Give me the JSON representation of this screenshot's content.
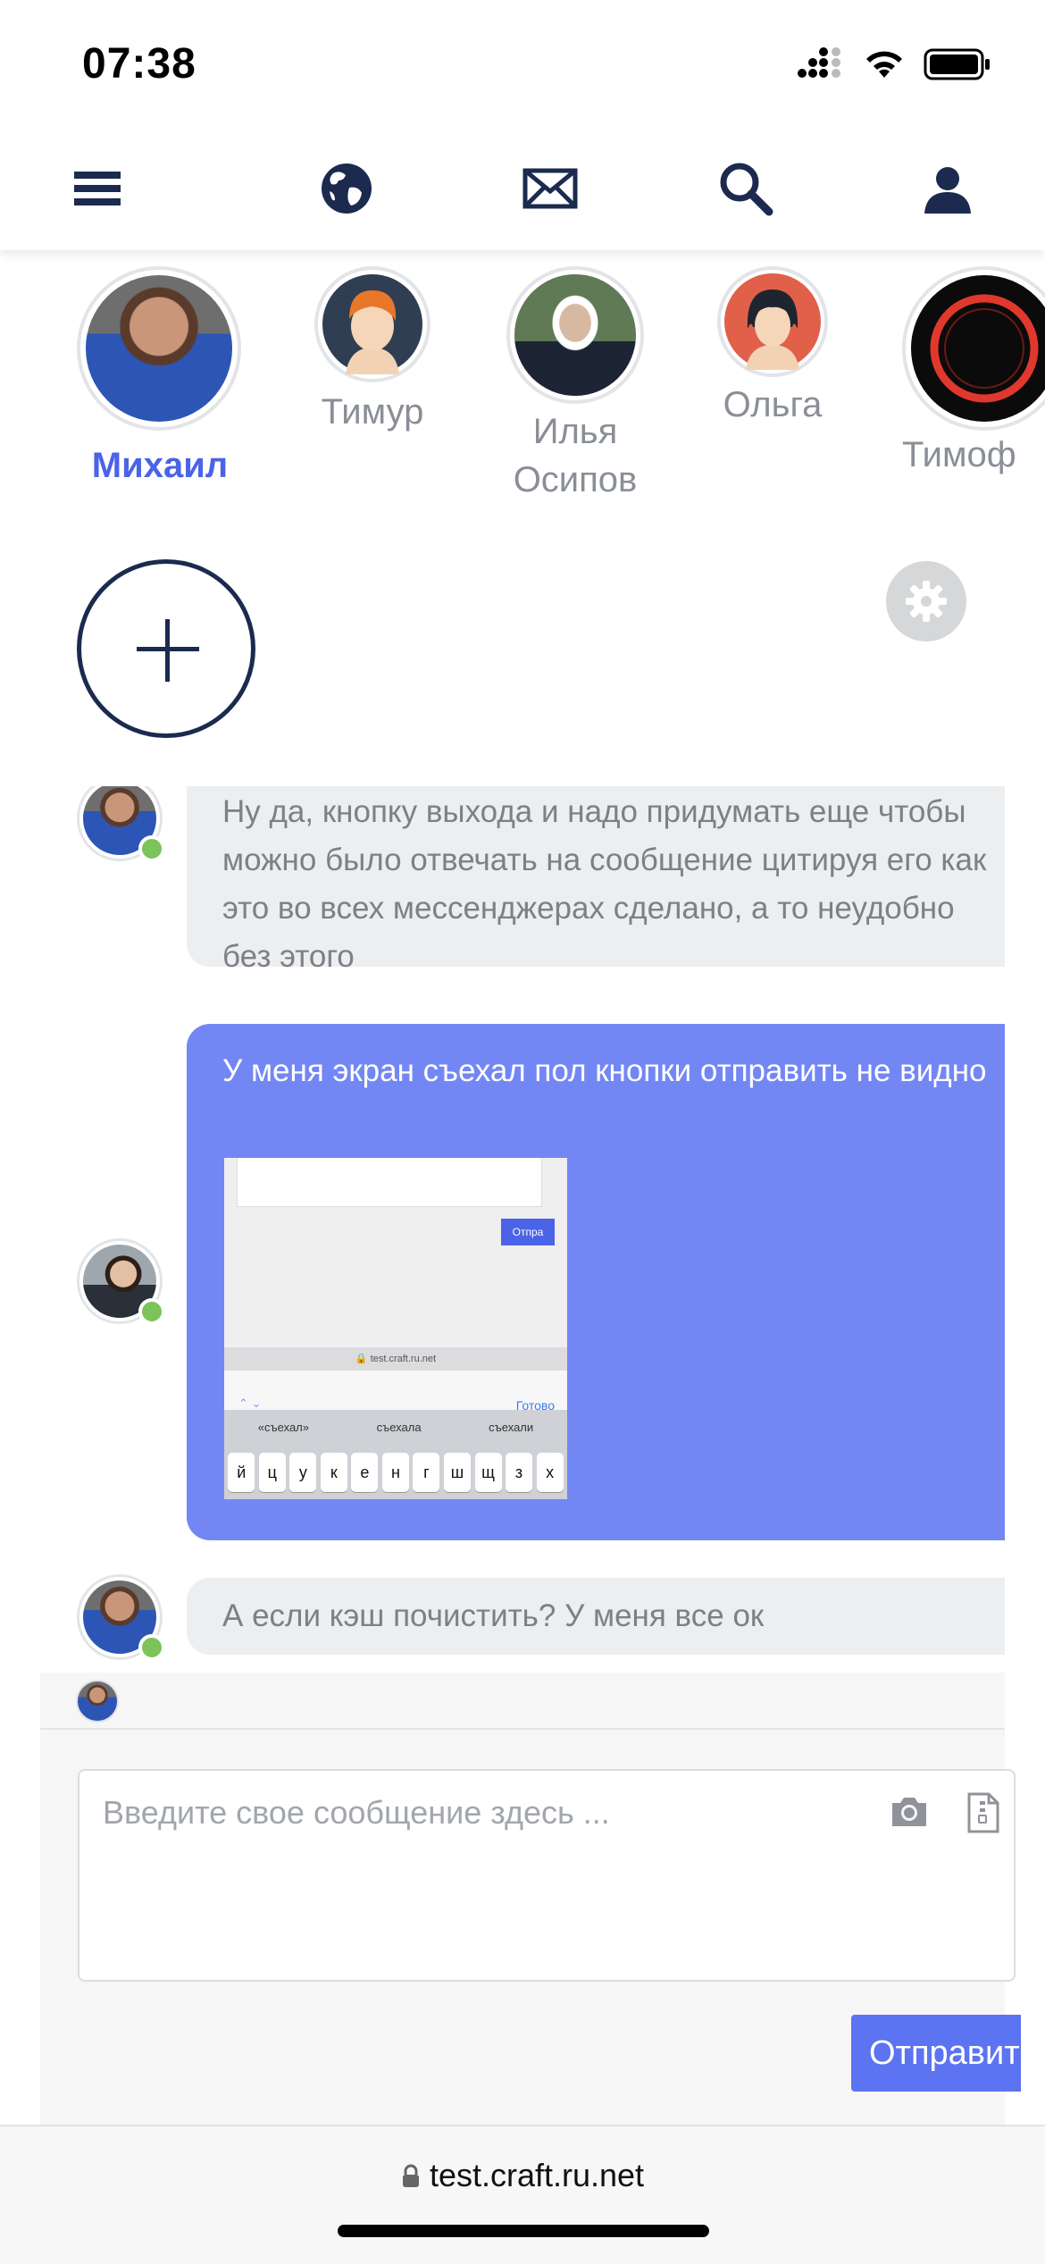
{
  "status_bar": {
    "time": "07:38"
  },
  "nav": {
    "items": [
      {
        "icon": "menu-icon"
      },
      {
        "icon": "globe-icon"
      },
      {
        "icon": "mail-icon"
      },
      {
        "icon": "search-icon"
      },
      {
        "icon": "user-icon"
      }
    ]
  },
  "stories": [
    {
      "name": "Михаил",
      "active": true
    },
    {
      "name": "Тимур",
      "active": false
    },
    {
      "name_line1": "Илья",
      "name_line2": "Осипов",
      "active": false
    },
    {
      "name": "Ольга",
      "active": false
    },
    {
      "name": "Тимоф",
      "active": false
    }
  ],
  "messages": [
    {
      "type": "incoming",
      "text": "Ну да, кнопку выхода и надо придумать еще чтобы можно было отвечать на сообщение цитируя его как это во всех мессенджерах сделано, а то неудобно без этого"
    },
    {
      "type": "outgoing",
      "text": "У меня экран съехал пол кнопки отправить не видно",
      "attachment": {
        "button_label": "Отпра",
        "url": "test.craft.ru.net",
        "done_label": "Готово",
        "suggestions": [
          "«съехал»",
          "съехала",
          "съехали"
        ],
        "keys": [
          "й",
          "ц",
          "у",
          "к",
          "е",
          "н",
          "г",
          "ш",
          "щ",
          "з",
          "х"
        ]
      }
    },
    {
      "type": "incoming",
      "text": "А если кэш почистить? У меня все ок"
    }
  ],
  "composer": {
    "placeholder": "Введите свое сообщение здесь ...",
    "send_label": "Отправить"
  },
  "browser": {
    "url": "test.craft.ru.net"
  },
  "colors": {
    "accent": "#4a63e7",
    "bubble_out": "#7387f4",
    "bubble_in": "#eceeef",
    "online": "#7cc35a",
    "navy": "#1b2a4e"
  }
}
